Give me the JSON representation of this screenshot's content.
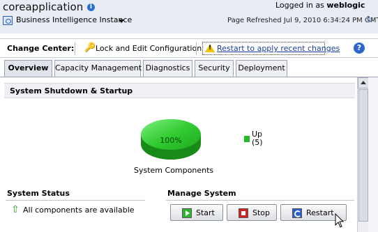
{
  "header": {
    "app_title": "coreapplication",
    "info_glyph": "i",
    "logged_in_prefix": "Logged in as",
    "user": "weblogic",
    "instance_label": "Business Intelligence Instance",
    "refreshed": "Page Refreshed Jul 9, 2010 6:34:24 PM GMT",
    "refresh_glyph": "↻"
  },
  "change_center": {
    "label": "Change Center:",
    "key_glyph": "🔑",
    "lock_label": "Lock and Edit Configuration",
    "restart_label": "Restart to apply recent changes",
    "help_glyph": "?"
  },
  "tabs": [
    {
      "label": "Overview",
      "active": true
    },
    {
      "label": "Capacity Management",
      "active": false
    },
    {
      "label": "Diagnostics",
      "active": false
    },
    {
      "label": "Security",
      "active": false
    },
    {
      "label": "Deployment",
      "active": false
    }
  ],
  "panel": {
    "title": "System Shutdown & Startup"
  },
  "chart_data": {
    "type": "pie",
    "slices": [
      {
        "label": "Up",
        "value": 5,
        "percent": 100,
        "color": "#22bb22"
      }
    ],
    "slice_label": "100%",
    "legend_entries": [
      {
        "label": "Up",
        "count": "(5)"
      }
    ],
    "caption": "System Components"
  },
  "status": {
    "title": "System Status",
    "arrow_glyph": "⇧",
    "text": "All components are available"
  },
  "manage": {
    "title": "Manage System",
    "start": "Start",
    "stop": "Stop",
    "restart": "Restart"
  },
  "colors": {
    "header_bg": "#e8ecf5",
    "pie_green": "#22bb22",
    "link_blue": "#1a3fa0"
  }
}
